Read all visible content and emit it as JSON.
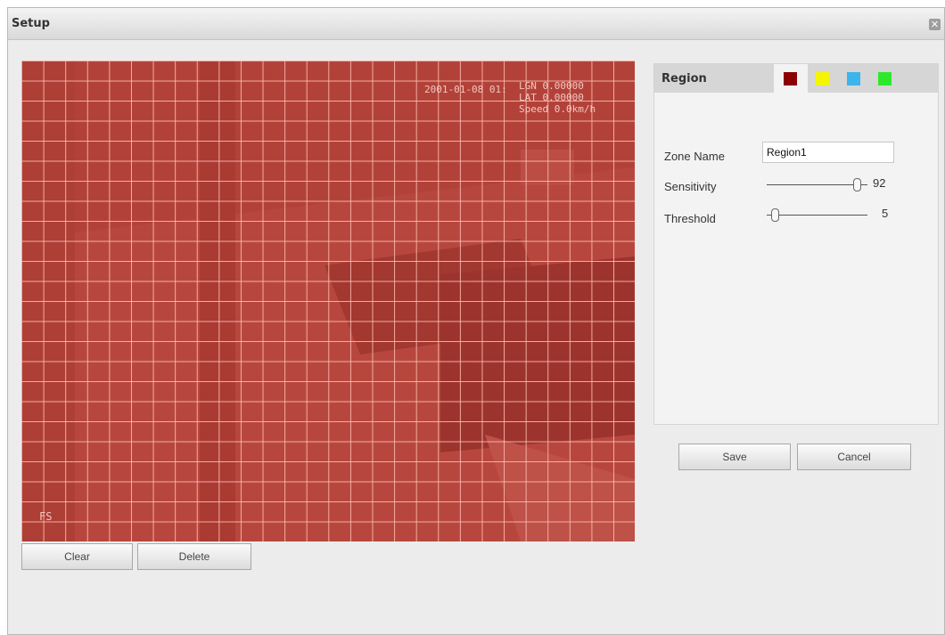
{
  "window": {
    "title": "Setup",
    "close_glyph": "✕"
  },
  "video": {
    "osd_time": "2001-01-08 01:",
    "osd_gps": "LGN 0.00000\nLAT 0.00000\nSpeed 0.0km/h",
    "osd_corner": "FS",
    "region_color": "#dc3c32"
  },
  "video_buttons": {
    "clear_label": "Clear",
    "delete_label": "Delete"
  },
  "panel": {
    "title": "Region",
    "swatches": [
      {
        "name": "red",
        "color": "#8b0000",
        "selected": true
      },
      {
        "name": "yellow",
        "color": "#f5f500"
      },
      {
        "name": "blue",
        "color": "#3cb4ec"
      },
      {
        "name": "green",
        "color": "#2ee82e"
      }
    ],
    "zone_name_label": "Zone Name",
    "zone_name_value": "Region1",
    "sensitivity_label": "Sensitivity",
    "sensitivity_value": "92",
    "threshold_label": "Threshold",
    "threshold_value": "5"
  },
  "actions": {
    "save_label": "Save",
    "cancel_label": "Cancel"
  }
}
